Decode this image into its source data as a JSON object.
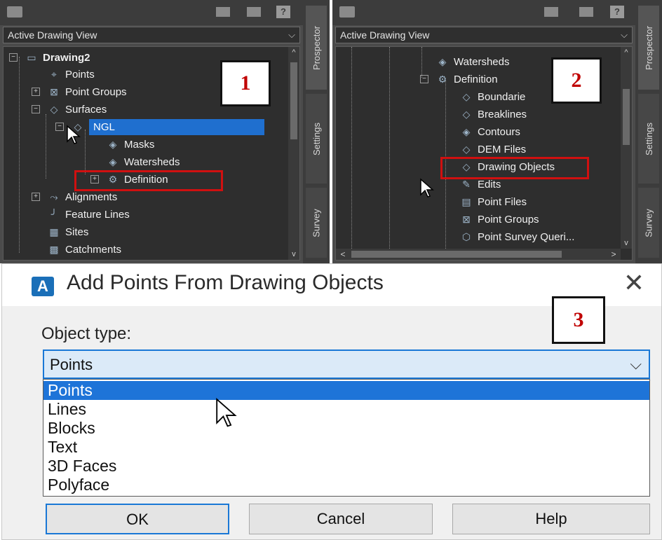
{
  "colors": {
    "panel_bg": "#4b4b4b",
    "tree_bg": "#2e2e2e",
    "selection": "#1f6fcf",
    "callout_text": "#c00000",
    "highlight_box": "#d01010",
    "dialog_accent": "#1a78d6"
  },
  "panel1": {
    "view_select": "Active Drawing View",
    "tabs": [
      "Prospector",
      "Settings",
      "Survey"
    ],
    "callout": "1",
    "tree": [
      {
        "label": "Drawing2",
        "icon": "drawing-icon"
      },
      {
        "label": "Points",
        "icon": "points-icon"
      },
      {
        "label": "Point Groups",
        "icon": "point-groups-icon"
      },
      {
        "label": "Surfaces",
        "icon": "surfaces-icon"
      },
      {
        "label": "NGL",
        "icon": "surface-icon"
      },
      {
        "label": "Masks",
        "icon": "masks-icon"
      },
      {
        "label": "Watersheds",
        "icon": "watersheds-icon"
      },
      {
        "label": "Definition",
        "icon": "definition-icon"
      },
      {
        "label": "Alignments",
        "icon": "alignments-icon"
      },
      {
        "label": "Feature Lines",
        "icon": "feature-lines-icon"
      },
      {
        "label": "Sites",
        "icon": "sites-icon"
      },
      {
        "label": "Catchments",
        "icon": "catchments-icon"
      }
    ]
  },
  "panel2": {
    "view_select": "Active Drawing View",
    "tabs": [
      "Prospector",
      "Settings",
      "Survey"
    ],
    "callout": "2",
    "tree": [
      {
        "label": "Watersheds",
        "icon": "watersheds-icon"
      },
      {
        "label": "Definition",
        "icon": "definition-icon"
      },
      {
        "label": "Boundarie",
        "icon": "boundaries-icon"
      },
      {
        "label": "Breaklines",
        "icon": "breaklines-icon"
      },
      {
        "label": "Contours",
        "icon": "contours-icon"
      },
      {
        "label": "DEM Files",
        "icon": "dem-files-icon"
      },
      {
        "label": "Drawing Objects",
        "icon": "drawing-objects-icon"
      },
      {
        "label": "Edits",
        "icon": "edits-icon"
      },
      {
        "label": "Point Files",
        "icon": "point-files-icon"
      },
      {
        "label": "Point Groups",
        "icon": "point-groups-icon"
      },
      {
        "label": "Point Survey Queri...",
        "icon": "point-survey-queries-icon"
      }
    ]
  },
  "dialog": {
    "title": "Add Points From Drawing Objects",
    "app_icon_letter": "A",
    "close": "✕",
    "callout": "3",
    "object_type_label": "Object type:",
    "combo_value": "Points",
    "options": [
      "Points",
      "Lines",
      "Blocks",
      "Text",
      "3D Faces",
      "Polyface"
    ],
    "selected_option": "Points",
    "buttons": {
      "ok": "OK",
      "cancel": "Cancel",
      "help": "Help"
    }
  }
}
